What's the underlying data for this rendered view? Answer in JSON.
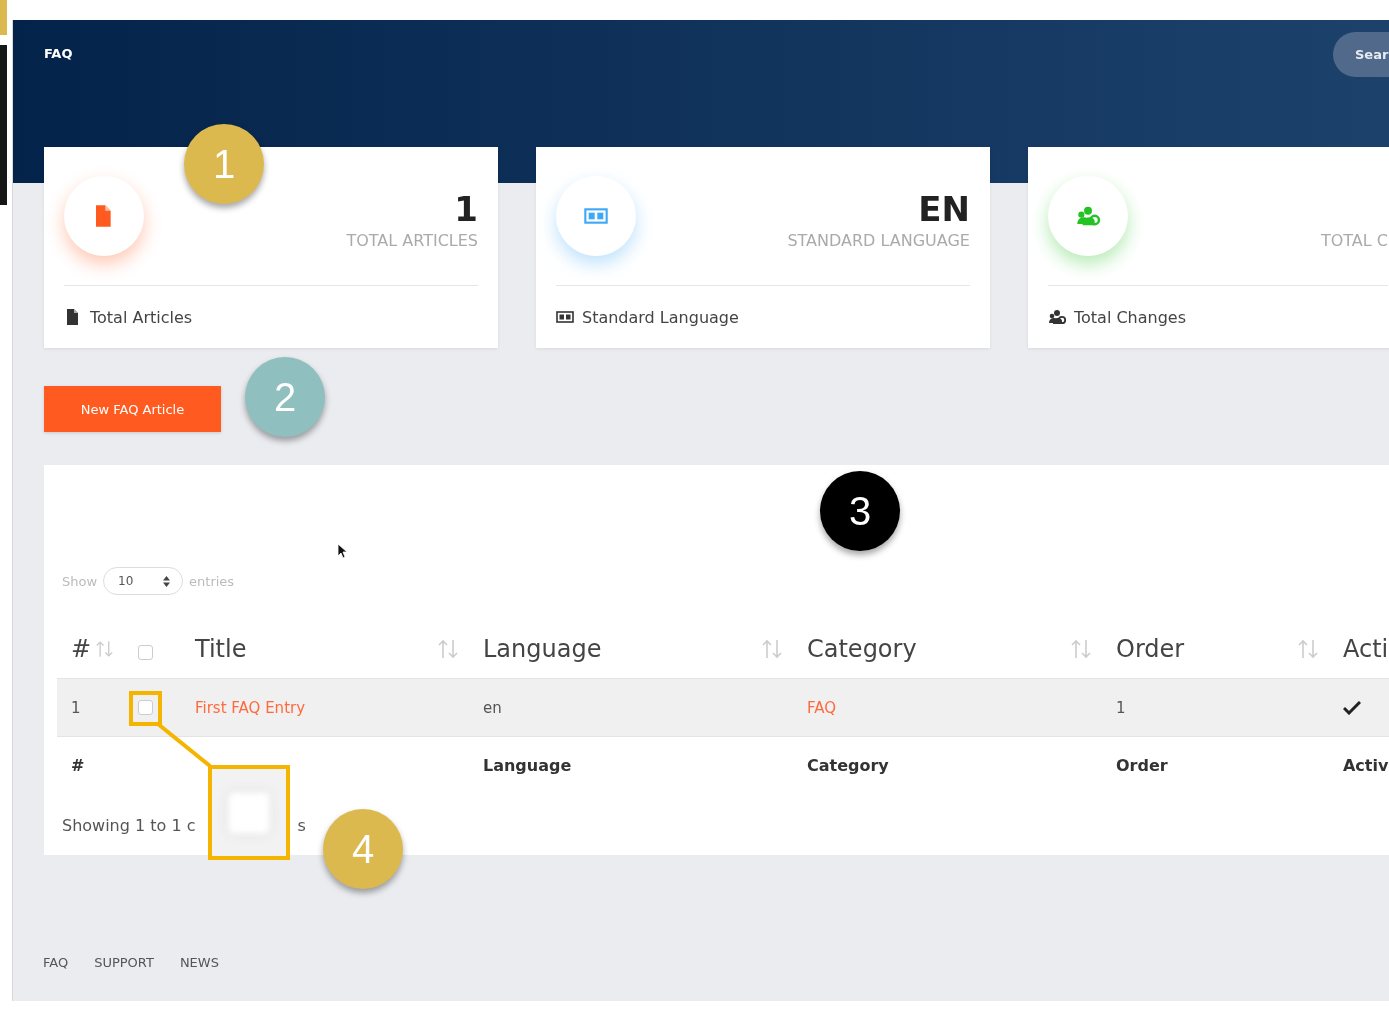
{
  "header": {
    "title": "FAQ",
    "search_button": "Sear"
  },
  "stats": [
    {
      "kind": "articles",
      "color": "#ff5a1f",
      "value": "1",
      "caption": "TOTAL ARTICLES",
      "label": "Total Articles"
    },
    {
      "kind": "language",
      "color": "#3fa9f5",
      "value": "EN",
      "caption": "STANDARD LANGUAGE",
      "label": "Standard Language"
    },
    {
      "kind": "changes",
      "color": "#22c322",
      "caption": "TOTAL C",
      "label": "Total Changes"
    }
  ],
  "new_button": "New FAQ Article",
  "table": {
    "show_label": "Show",
    "page_size": "10",
    "entries_label": "entries",
    "columns": [
      {
        "label": "#",
        "sortable": true
      },
      {
        "kind": "checkbox",
        "checked": false
      },
      {
        "label": "Title",
        "sortable": true
      },
      {
        "label": "Language",
        "sortable": true
      },
      {
        "label": "Category",
        "sortable": true
      },
      {
        "label": "Order",
        "sortable": true
      },
      {
        "label": "Acti",
        "sortable": false
      }
    ],
    "rows": [
      {
        "number": "1",
        "checked": false,
        "title": "First FAQ Entry",
        "language": "en",
        "category": "FAQ",
        "order": "1",
        "active": true
      }
    ],
    "footer_columns": [
      "#",
      "Language",
      "Category",
      "Order",
      "Activ"
    ],
    "info_parts": [
      "Showing 1 to 1 c",
      "s"
    ]
  },
  "footer_links": [
    "FAQ",
    "SUPPORT",
    "NEWS"
  ],
  "callouts": [
    {
      "number": "1",
      "color": "#dcb94f"
    },
    {
      "number": "2",
      "color": "#8fc0bf"
    },
    {
      "number": "3",
      "color": "#000000"
    },
    {
      "number": "4",
      "color": "#dcb94f"
    }
  ]
}
